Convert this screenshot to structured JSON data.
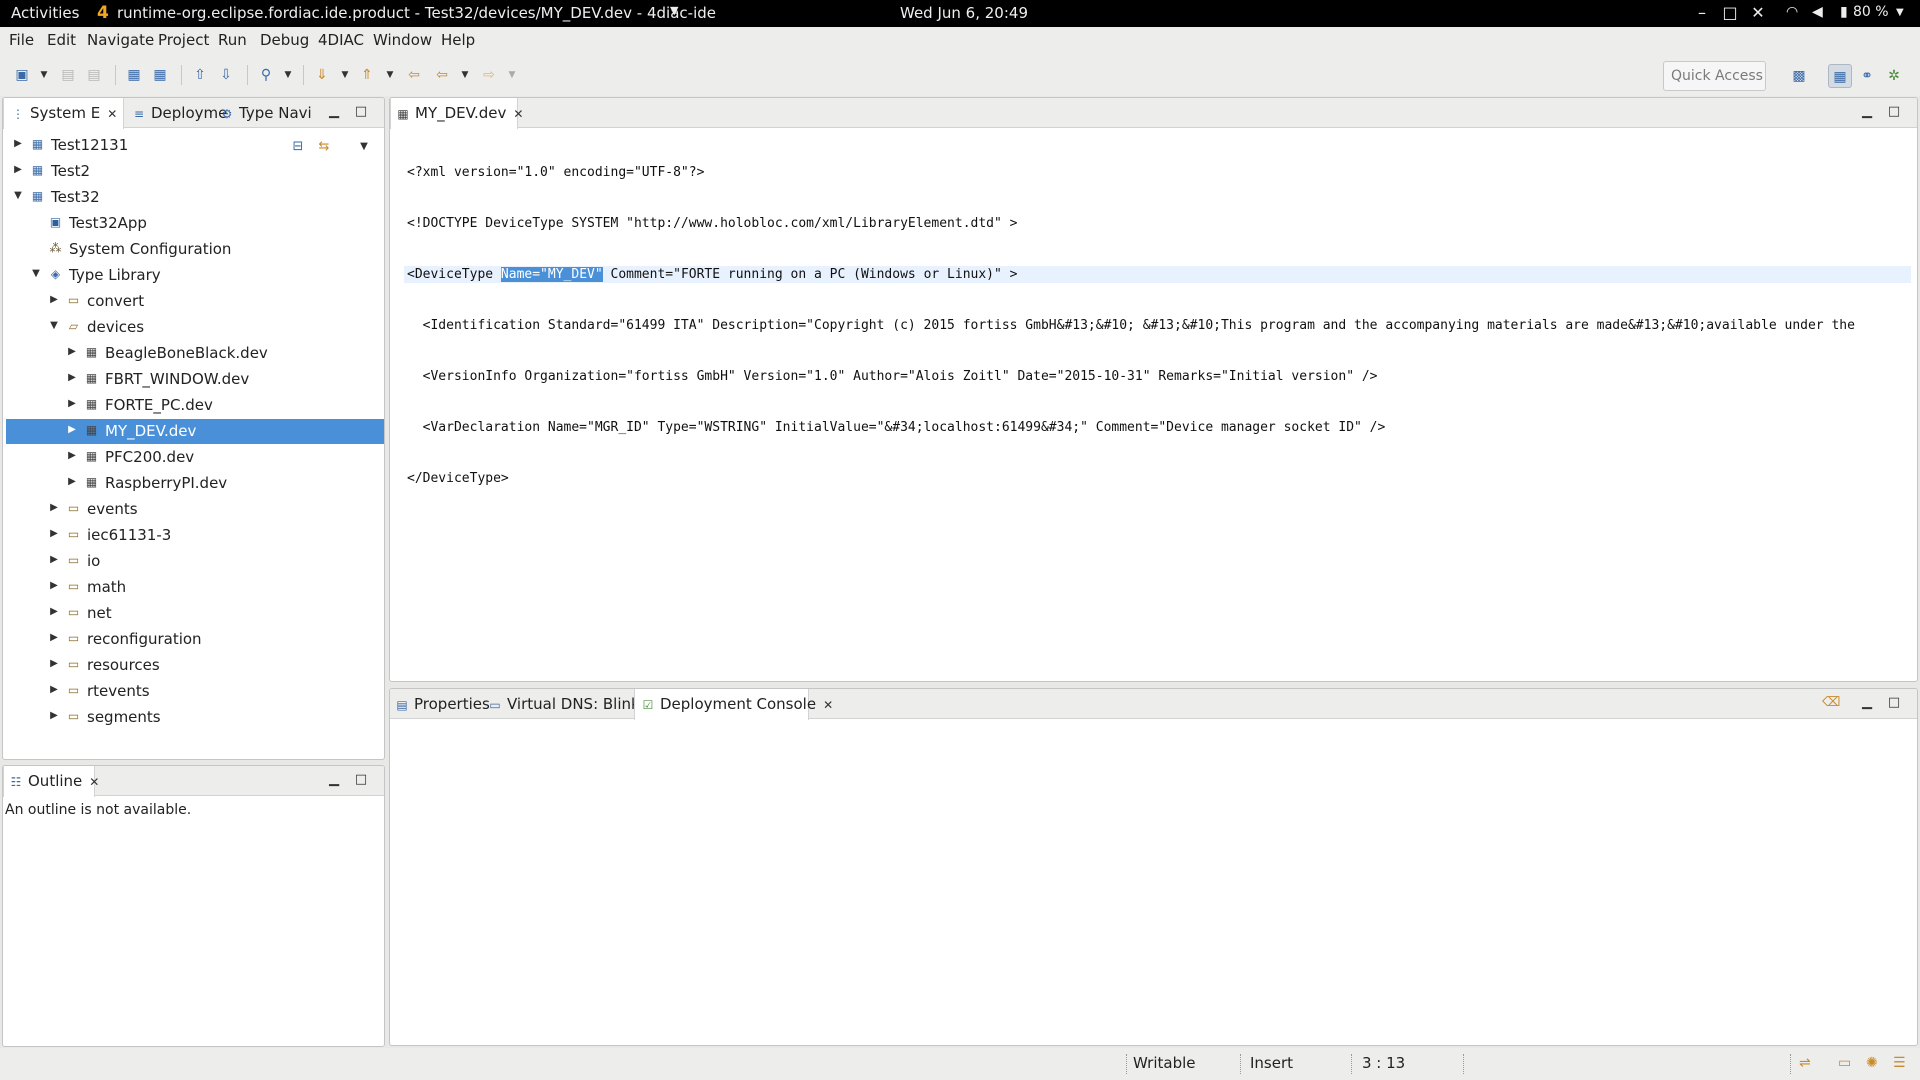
{
  "topbar": {
    "activities": "Activities",
    "window_title": "runtime-org.eclipse.fordiac.ide.product - Test32/devices/MY_DEV.dev - 4diac-ide",
    "clock": "Wed Jun  6, 20:49",
    "battery": "80 %"
  },
  "menu": [
    "File",
    "Edit",
    "Navigate",
    "Project",
    "Run",
    "Debug",
    "4DIAC",
    "Window",
    "Help"
  ],
  "toolbar": {
    "quick_access_placeholder": "Quick Access"
  },
  "left_panel": {
    "tabs": [
      "System E",
      "Deployme",
      "Type Navi"
    ],
    "tree": [
      {
        "label": "Test12131",
        "depth": 0,
        "expanded": false,
        "icon": "project-icon"
      },
      {
        "label": "Test2",
        "depth": 0,
        "expanded": false,
        "icon": "project-icon"
      },
      {
        "label": "Test32",
        "depth": 0,
        "expanded": true,
        "icon": "project-icon"
      },
      {
        "label": "Test32App",
        "depth": 1,
        "leaf": true,
        "icon": "application-icon"
      },
      {
        "label": "System Configuration",
        "depth": 1,
        "leaf": true,
        "icon": "system-config-icon"
      },
      {
        "label": "Type Library",
        "depth": 1,
        "expanded": true,
        "icon": "type-library-icon"
      },
      {
        "label": "convert",
        "depth": 2,
        "expanded": false,
        "icon": "folder-icon"
      },
      {
        "label": "devices",
        "depth": 2,
        "expanded": true,
        "icon": "folder-open-icon"
      },
      {
        "label": "BeagleBoneBlack.dev",
        "depth": 3,
        "expanded": false,
        "icon": "device-icon"
      },
      {
        "label": "FBRT_WINDOW.dev",
        "depth": 3,
        "expanded": false,
        "icon": "device-icon"
      },
      {
        "label": "FORTE_PC.dev",
        "depth": 3,
        "expanded": false,
        "icon": "device-icon"
      },
      {
        "label": "MY_DEV.dev",
        "depth": 3,
        "expanded": false,
        "icon": "device-icon",
        "selected": true
      },
      {
        "label": "PFC200.dev",
        "depth": 3,
        "expanded": false,
        "icon": "device-icon"
      },
      {
        "label": "RaspberryPI.dev",
        "depth": 3,
        "expanded": false,
        "icon": "device-icon"
      },
      {
        "label": "events",
        "depth": 2,
        "expanded": false,
        "icon": "folder-icon"
      },
      {
        "label": "iec61131-3",
        "depth": 2,
        "expanded": false,
        "icon": "folder-icon"
      },
      {
        "label": "io",
        "depth": 2,
        "expanded": false,
        "icon": "folder-icon"
      },
      {
        "label": "math",
        "depth": 2,
        "expanded": false,
        "icon": "folder-icon"
      },
      {
        "label": "net",
        "depth": 2,
        "expanded": false,
        "icon": "folder-icon"
      },
      {
        "label": "reconfiguration",
        "depth": 2,
        "expanded": false,
        "icon": "folder-icon"
      },
      {
        "label": "resources",
        "depth": 2,
        "expanded": false,
        "icon": "folder-icon"
      },
      {
        "label": "rtevents",
        "depth": 2,
        "expanded": false,
        "icon": "folder-icon"
      },
      {
        "label": "segments",
        "depth": 2,
        "expanded": false,
        "icon": "folder-icon"
      }
    ]
  },
  "outline": {
    "tab": "Outline",
    "message": "An outline is not available."
  },
  "editor": {
    "tab": "MY_DEV.dev",
    "lines": {
      "l1": "<?xml version=\"1.0\" encoding=\"UTF-8\"?>",
      "l2": "<!DOCTYPE DeviceType SYSTEM \"http://www.holobloc.com/xml/LibraryElement.dtd\" >",
      "l3a": "<DeviceType ",
      "l3b": "Name=\"MY_DEV\"",
      "l3c": " Comment=\"FORTE running on a PC (Windows or Linux)\" >",
      "l4": "  <Identification Standard=\"61499 ITA\" Description=\"Copyright (c) 2015 fortiss GmbH&#13;&#10; &#13;&#10;This program and the accompanying materials are made&#13;&#10;available under the",
      "l5": "  <VersionInfo Organization=\"fortiss GmbH\" Version=\"1.0\" Author=\"Alois Zoitl\" Date=\"2015-10-31\" Remarks=\"Initial version\" />",
      "l6": "  <VarDeclaration Name=\"MGR_ID\" Type=\"WSTRING\" InitialValue=\"&#34;localhost:61499&#34;\" Comment=\"Device manager socket ID\" />",
      "l7": "</DeviceType>"
    }
  },
  "bottom_panel": {
    "tabs": [
      "Properties",
      "Virtual DNS: Blinky",
      "Deployment Console"
    ]
  },
  "status": {
    "writable": "Writable",
    "insert": "Insert",
    "position": "3 : 13"
  }
}
